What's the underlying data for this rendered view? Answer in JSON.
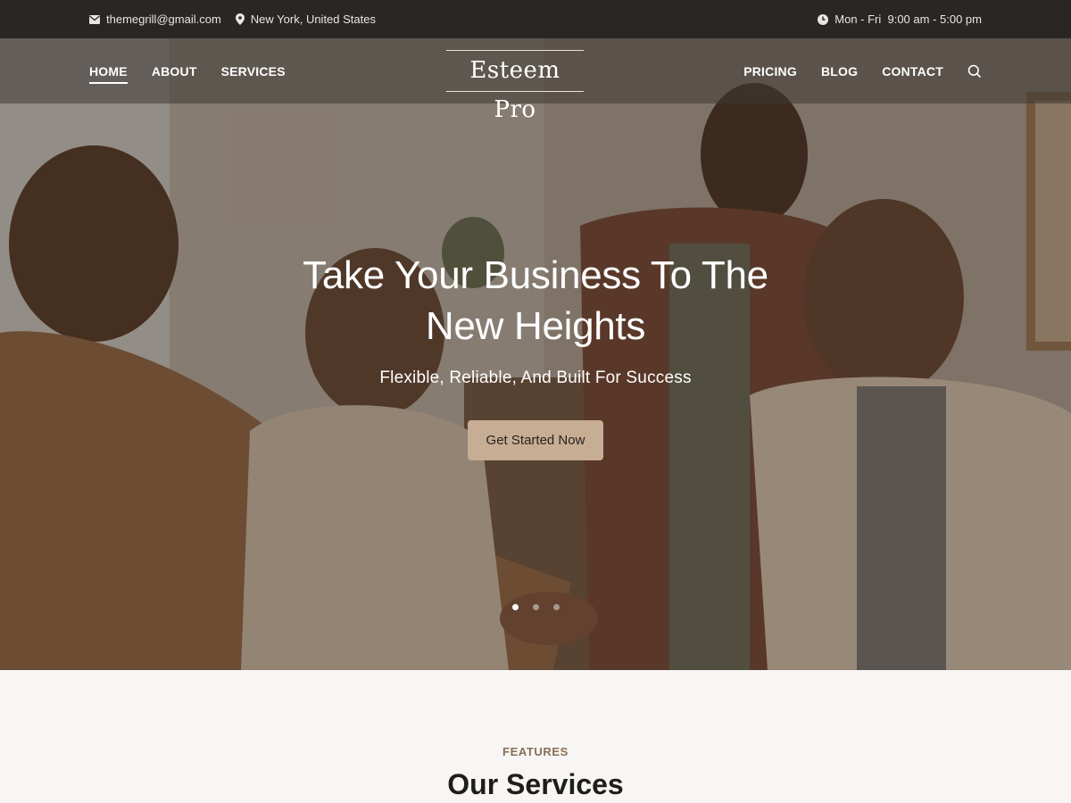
{
  "topbar": {
    "email": "themegrill@gmail.com",
    "location": "New York, United States",
    "hours": "Mon - Fri  9:00 am - 5:00 pm",
    "icons": {
      "email": "envelope-icon",
      "location": "map-pin-icon",
      "hours": "clock-icon"
    }
  },
  "nav": {
    "left": [
      {
        "label": "HOME",
        "active": true
      },
      {
        "label": "ABOUT"
      },
      {
        "label": "SERVICES"
      }
    ],
    "right": [
      {
        "label": "PRICING"
      },
      {
        "label": "BLOG"
      },
      {
        "label": "CONTACT"
      }
    ],
    "logo": "Esteem Pro",
    "search_icon": "search-icon"
  },
  "hero": {
    "title_line1": "Take Your Business To The",
    "title_line2": "New Heights",
    "subtitle": "Flexible, Reliable, And Built For Success",
    "cta": "Get Started Now",
    "slides": {
      "count": 3,
      "active": 1
    }
  },
  "features": {
    "eyebrow": "FEATURES",
    "title": "Our Services"
  },
  "colors": {
    "topbar_bg": "#2a2623",
    "accent": "#c7ad94",
    "eyebrow": "#8a6e54",
    "section_bg": "#f7f6f4"
  }
}
